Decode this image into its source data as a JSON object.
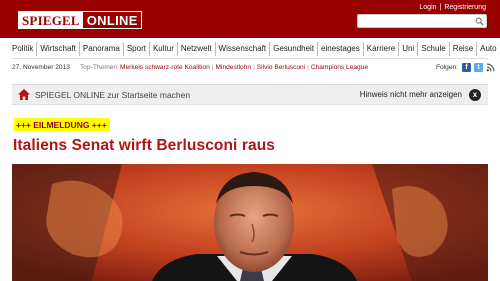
{
  "header": {
    "logo": {
      "part1": "SPIEGEL",
      "part2": "ONLINE"
    },
    "links": {
      "login": "Login",
      "separator": "|",
      "register": "Registrierung"
    },
    "search": {
      "placeholder": "",
      "value": ""
    }
  },
  "nav": {
    "items": [
      "Politik",
      "Wirtschaft",
      "Panorama",
      "Sport",
      "Kultur",
      "Netzwelt",
      "Wissenschaft",
      "Gesundheit",
      "einestages",
      "Karriere",
      "Uni",
      "Schule",
      "Reise",
      "Auto"
    ]
  },
  "topbar": {
    "date": "27. November 2013",
    "top_themen_label": "Top-Themen:",
    "topics": [
      "Merkels schwarz-rote Koalition",
      "Mindestlohn",
      "Silvio Berlusconi",
      "Champions League"
    ],
    "separator": "|",
    "follow_label": "Folgen:",
    "facebook_glyph": "f",
    "twitter_glyph": "t"
  },
  "startpage_bar": {
    "text": "SPIEGEL ONLINE zur Startseite machen",
    "hint": "Hinweis nicht mehr anzeigen",
    "close_glyph": "x"
  },
  "article": {
    "breaking_label": "+++ EILMELDUNG +++",
    "headline": "Italiens Senat wirft Berlusconi raus"
  },
  "colors": {
    "brand_red": "#990000",
    "headline_red": "#b01515",
    "breaking_bg": "#ffff00"
  },
  "icons": {
    "home": "home-icon",
    "search": "search-icon",
    "close": "close-icon",
    "facebook": "facebook-icon",
    "twitter": "twitter-icon",
    "rss": "rss-icon"
  }
}
